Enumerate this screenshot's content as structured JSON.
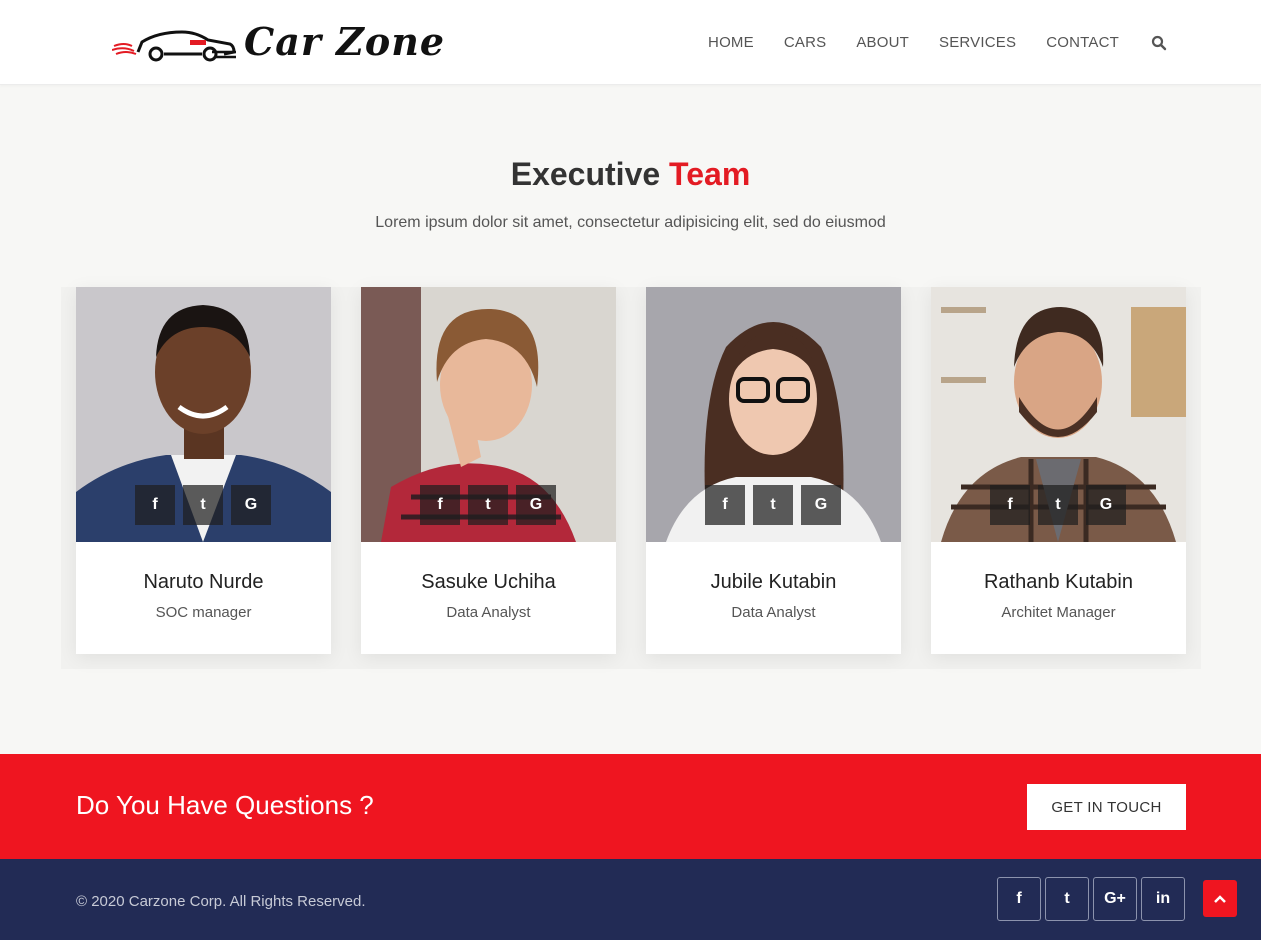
{
  "brand": {
    "name": "Car Zone",
    "accent": "#e31b23"
  },
  "nav": {
    "items": [
      "HOME",
      "CARS",
      "ABOUT",
      "SERVICES",
      "CONTACT"
    ]
  },
  "team": {
    "title_main": "Executive",
    "title_accent": "Team",
    "subtitle": "Lorem ipsum dolor sit amet, consectetur adipisicing elit, sed do eiusmod",
    "members": [
      {
        "name": "Naruto Nurde",
        "role": "SOC manager"
      },
      {
        "name": "Sasuke Uchiha",
        "role": "Data Analyst"
      },
      {
        "name": "Jubile Kutabin",
        "role": "Data Analyst"
      },
      {
        "name": "Rathanb Kutabin",
        "role": "Architet Manager"
      }
    ],
    "social_icons": [
      "facebook-icon",
      "twitter-icon",
      "google-icon"
    ]
  },
  "cta": {
    "text": "Do You Have Questions ?",
    "button": "GET IN TOUCH",
    "color": "#ef1520"
  },
  "footer": {
    "copyright": "© 2020 Carzone Corp. All Rights Reserved.",
    "background": "#222b55",
    "social_icons": [
      "facebook-icon",
      "twitter-icon",
      "google-plus-icon",
      "linkedin-icon"
    ]
  }
}
